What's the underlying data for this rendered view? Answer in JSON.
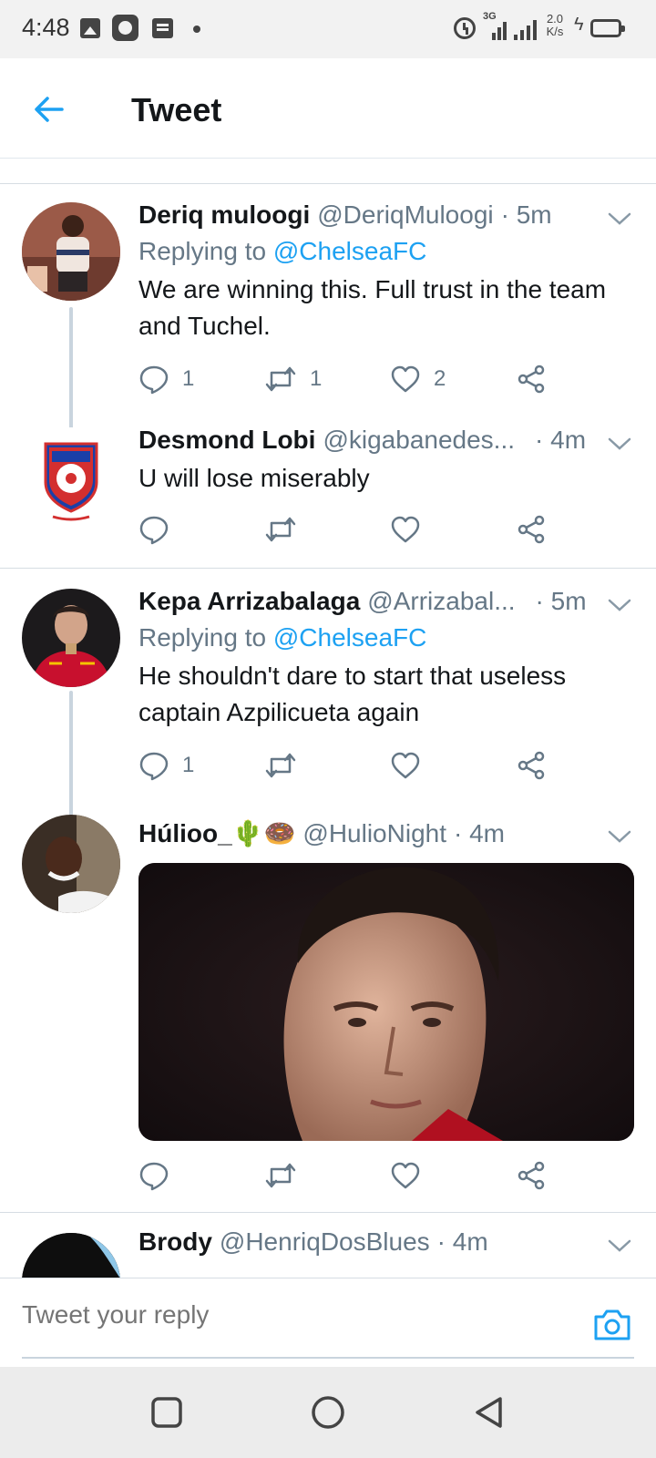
{
  "status_bar": {
    "time": "4:48",
    "network_label": "3G",
    "speed_value": "2.0",
    "speed_unit": "K/s",
    "icons": [
      "image-icon",
      "app-icon",
      "message-icon",
      "dot-icon",
      "alarm-icon",
      "signal-icon",
      "signal-icon",
      "charging-icon",
      "battery-icon"
    ]
  },
  "header": {
    "title": "Tweet",
    "back_icon": "arrow-left-icon"
  },
  "colors": {
    "accent": "#1da1f2",
    "secondary_text": "#657786",
    "primary_text": "#14171a",
    "divider": "#d6dde3"
  },
  "tweets": [
    {
      "name": "Deriq muloogi",
      "handle": "@DeriqMuloogi",
      "time": "· 5m",
      "replying_prefix": "Replying to",
      "replying_to": "@ChelseaFC",
      "text": "We are winning this. Full trust in the team and Tuchel.",
      "replies": "1",
      "retweets": "1",
      "likes": "2"
    },
    {
      "name": "Desmond Lobi",
      "handle": "@kigabanedes...",
      "time": "· 4m",
      "text": "U will lose miserably",
      "replies": "",
      "retweets": "",
      "likes": ""
    },
    {
      "name": "Kepa Arrizabalaga",
      "handle": "@Arrizabal...",
      "time": "· 5m",
      "replying_prefix": "Replying to",
      "replying_to": "@ChelseaFC",
      "text": "He shouldn't dare to start that useless captain Azpilicueta again",
      "replies": "1",
      "retweets": "",
      "likes": ""
    },
    {
      "name": "Húlioo_🌵🍩",
      "handle": "@HulioNight",
      "time": "· 4m",
      "text": "",
      "media_subject": "photo of a footballer",
      "replies": "",
      "retweets": "",
      "likes": ""
    },
    {
      "name": "Brody",
      "handle": "@HenriqDosBlues",
      "time": "· 4m"
    }
  ],
  "reply_bar": {
    "placeholder": "Tweet your reply",
    "camera_icon": "camera-icon"
  },
  "nav_bar": {
    "icons": [
      "recents-square-icon",
      "home-circle-icon",
      "back-triangle-icon"
    ]
  }
}
